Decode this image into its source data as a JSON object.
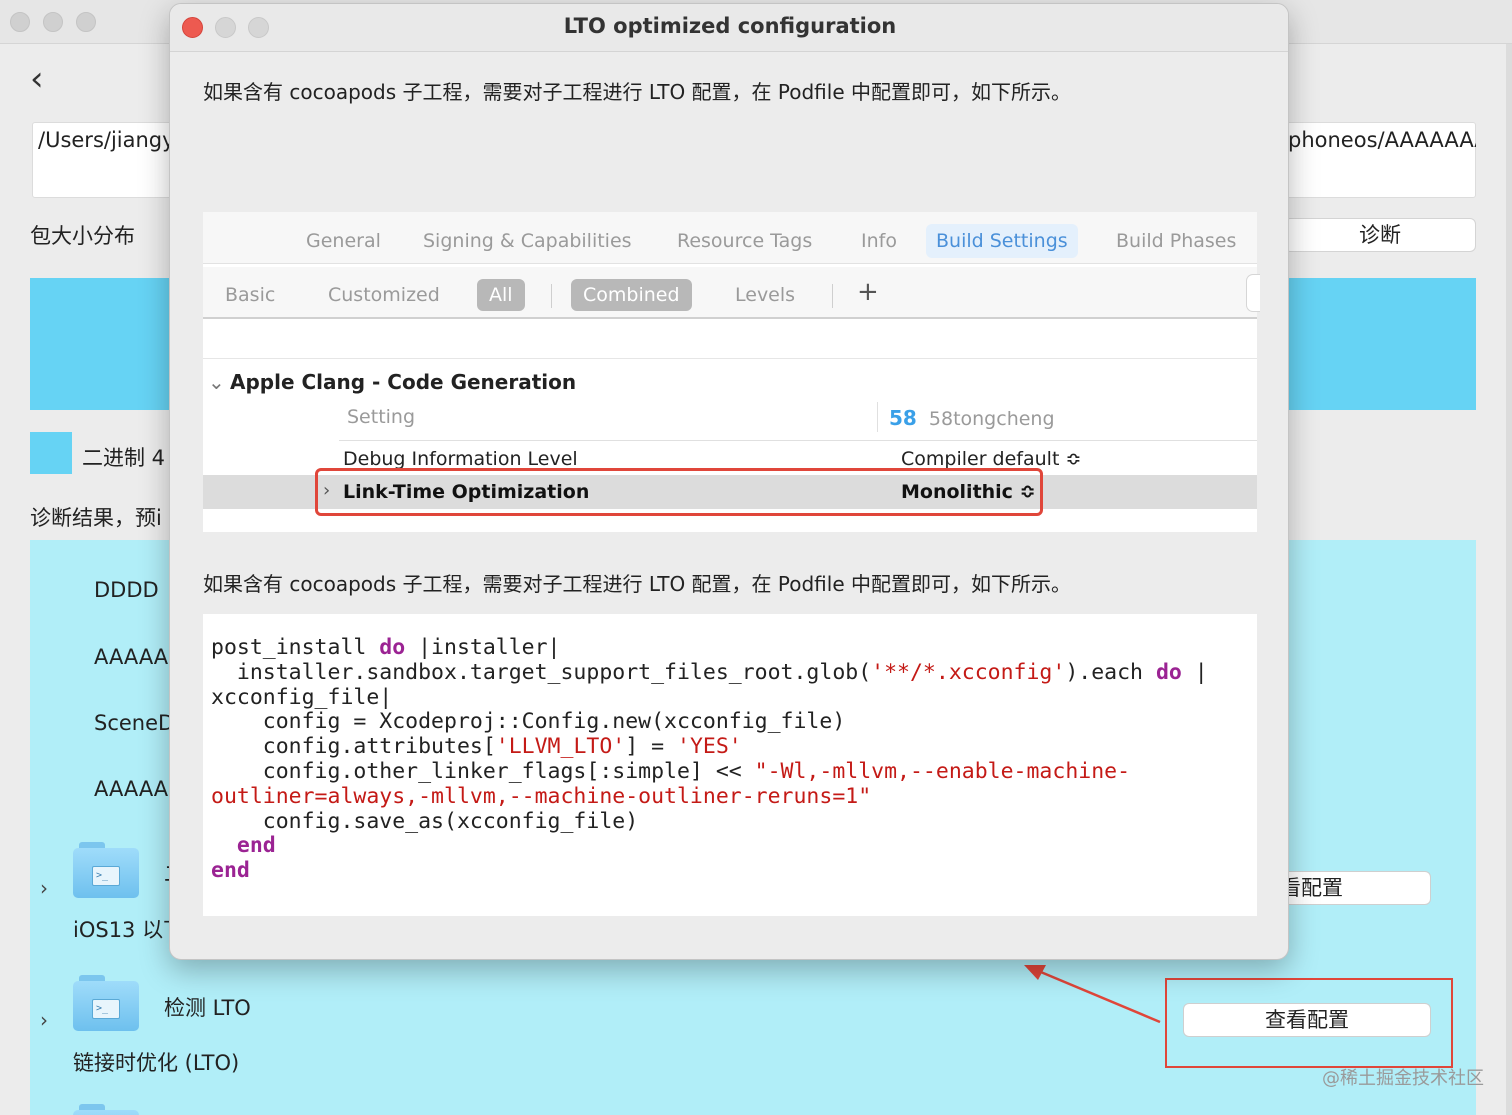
{
  "background": {
    "path_left": "/Users/jiangy",
    "path_right": "phoneos/AAAAAAA",
    "package_label": "包大小分布",
    "diagnose_button": "诊断",
    "legend_text": "二进制 4",
    "diagnose_result": "诊断结果，预i",
    "items": [
      "DDDD",
      "AAAAA",
      "SceneD",
      "AAAAA"
    ],
    "row1_subtitle": "iOS13 以下",
    "row1_title_fragment": "二",
    "row1_button": "看配置",
    "row2_title": "检测 LTO",
    "row2_subtitle": "链接时优化 (LTO)",
    "row2_button": "查看配置",
    "watermark": "@稀土掘金技术社区"
  },
  "dialog": {
    "title": "LTO optimized configuration",
    "text_top": "如果含有 cocoapods 子工程，需要对子工程进行 LTO 配置，在 Podfile 中配置即可，如下所示。",
    "text_bottom": "如果含有 cocoapods 子工程，需要对子工程进行 LTO 配置，在 Podfile 中配置即可，如下所示。",
    "xcode": {
      "tabs": [
        "General",
        "Signing & Capabilities",
        "Resource Tags",
        "Info",
        "Build Settings",
        "Build Phases"
      ],
      "active_tab": "Build Settings",
      "filters": [
        "Basic",
        "Customized",
        "All",
        "Combined",
        "Levels"
      ],
      "plus": "+",
      "section_title": "Apple Clang - Code Generation",
      "header_setting": "Setting",
      "header_target_logo": "58",
      "header_target": "58tongcheng",
      "rows": [
        {
          "name": "Debug Information Level",
          "value": "Compiler default ≎"
        },
        {
          "name": "Link-Time Optimization",
          "value": "Monolithic ≎"
        }
      ]
    }
  },
  "colors": {
    "accent_blue": "#66d3f4",
    "panel_cyan": "#b1eef8",
    "highlight_red": "#e0463a",
    "keyword": "#9b2393",
    "string": "#c41a16"
  }
}
